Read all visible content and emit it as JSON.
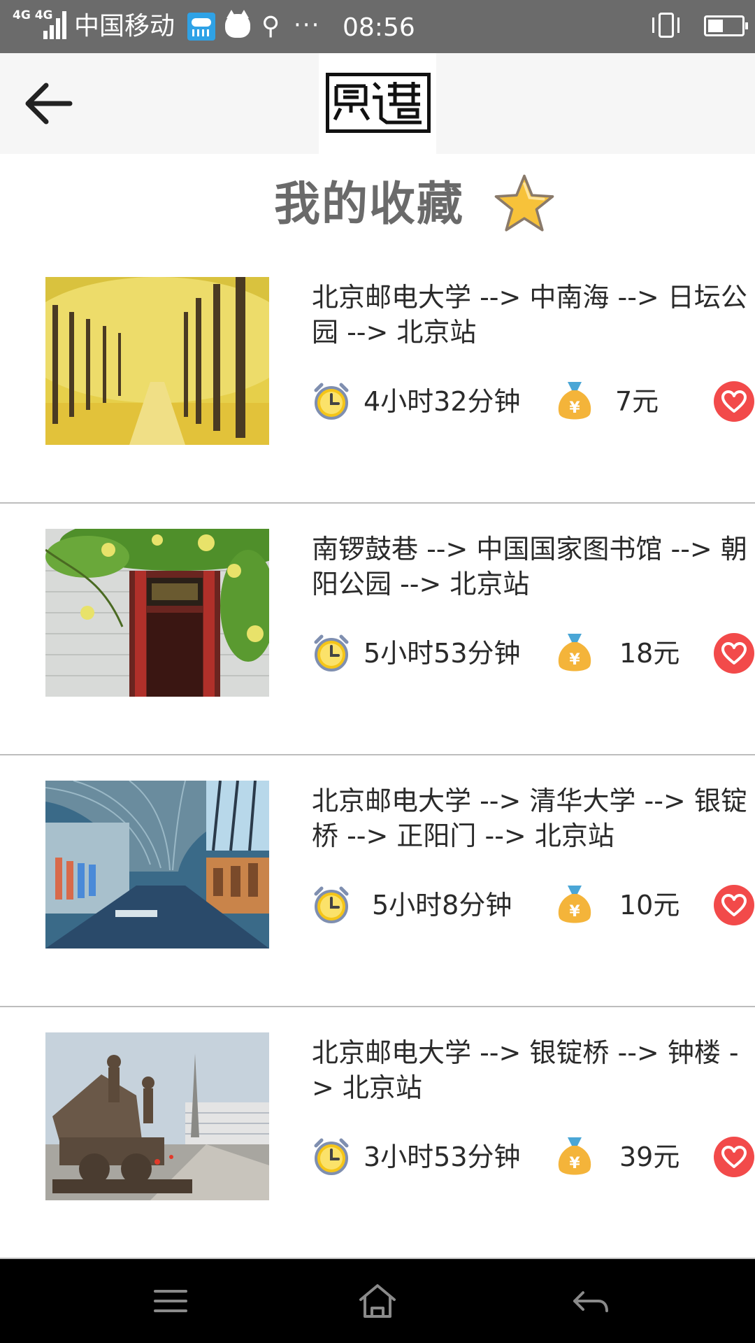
{
  "status_bar": {
    "network_1": "4G",
    "network_2": "4G",
    "carrier": "中国移动",
    "time": "08:56",
    "battery_level": 0.45,
    "icons": [
      "signal-icon",
      "weather-rain-icon",
      "cat-icon",
      "usb-icon",
      "more-dots-icon",
      "vibrate-icon",
      "battery-icon"
    ]
  },
  "header": {
    "back_icon": "arrow-left-icon",
    "logo_text": "觅迹"
  },
  "page": {
    "title": "我的收藏",
    "title_icon": "star-icon"
  },
  "colors": {
    "heart": "#f24a4a",
    "clock": "#f5c518",
    "bag": "#f4b43a",
    "star": "#f7c23a",
    "title": "#6a6a6a"
  },
  "favorites": [
    {
      "route": "北京邮电大学 --> 中南海 --> 日坛公园 --> 北京站",
      "duration": "4小时32分钟",
      "price": "7元",
      "photo": "ginkgo-avenue-photo"
    },
    {
      "route": "南锣鼓巷 --> 中国国家图书馆 --> 朝阳公园 --> 北京站",
      "duration": "5小时53分钟",
      "price": "18元",
      "photo": "hutong-gate-photo"
    },
    {
      "route": "北京邮电大学 --> 清华大学 --> 银锭桥 --> 正阳门 --> 北京站",
      "duration": "5小时8分钟",
      "price": "10元",
      "photo": "museum-corridor-photo"
    },
    {
      "route": "北京邮电大学 --> 银锭桥 --> 钟楼 -> 北京站",
      "duration": "3小时53分钟",
      "price": "39元",
      "photo": "military-museum-photo"
    }
  ],
  "nav_bar": {
    "icons": [
      "menu-icon",
      "home-icon",
      "back-icon"
    ]
  }
}
